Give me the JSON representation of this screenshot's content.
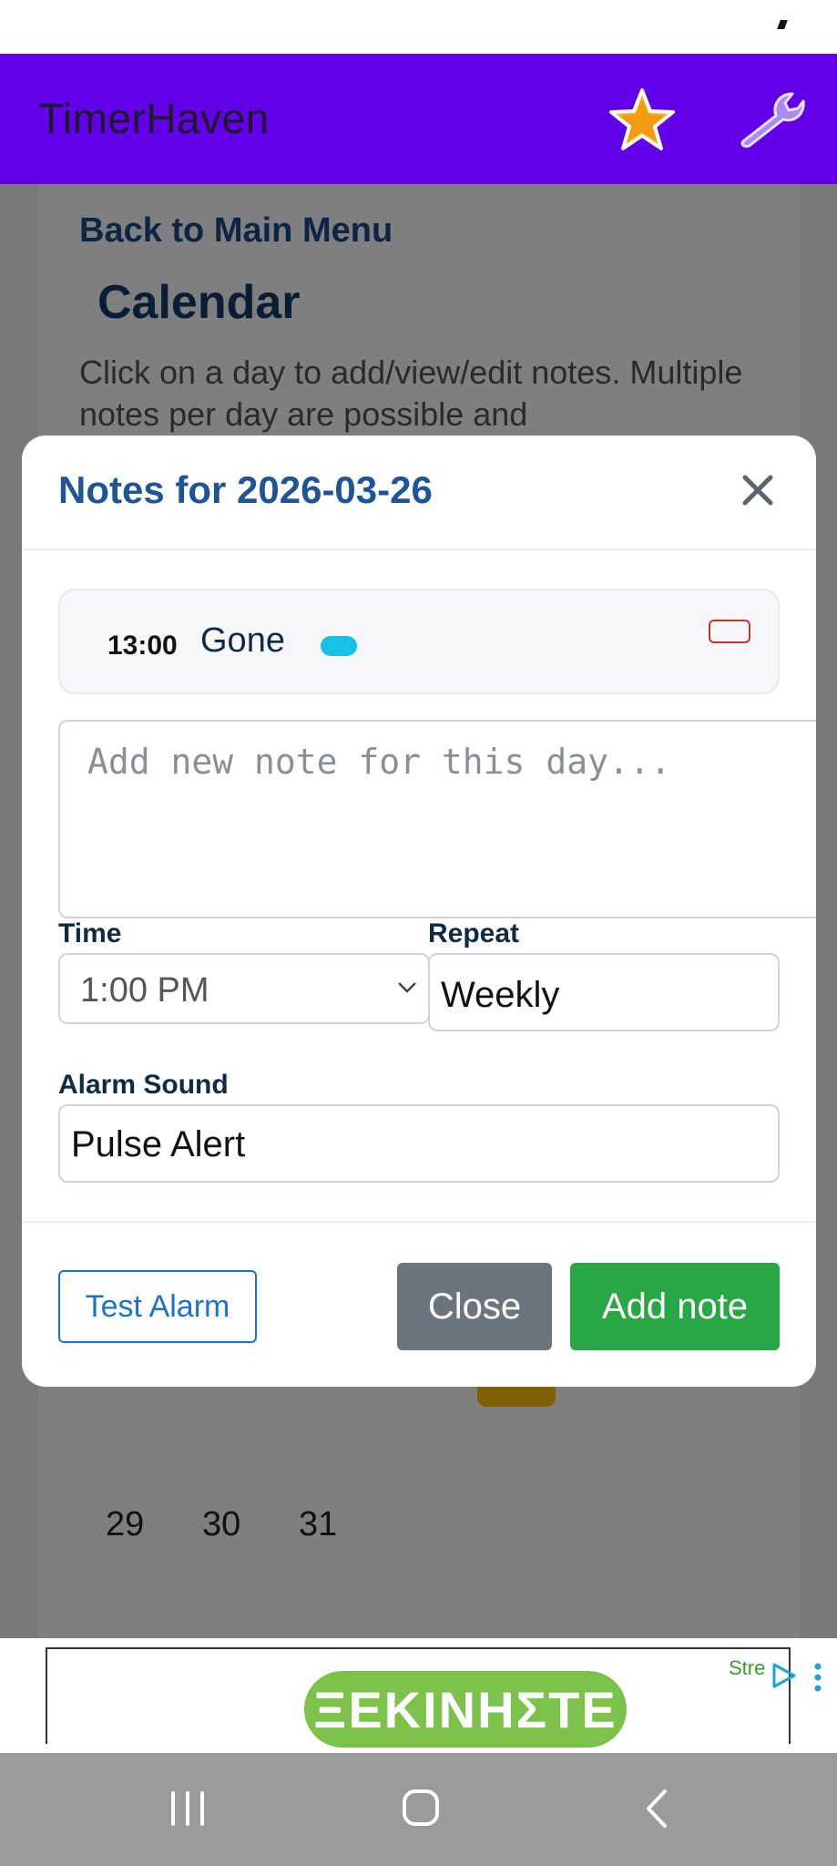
{
  "app": {
    "title": "TimerHaven",
    "icons": {
      "favorite": "star-icon",
      "settings": "wrench-icon"
    },
    "colors": {
      "appbar": "#6200ea",
      "link": "#1a4a8a"
    }
  },
  "page": {
    "back_link": "Back to Main Menu",
    "title": "Calendar",
    "description": "Click on a day to add/view/edit notes. Multiple notes per day are possible and",
    "visible_days": [
      "29",
      "30",
      "31"
    ]
  },
  "modal": {
    "title": "Notes for 2026-03-26",
    "notes": [
      {
        "time": "13:00",
        "text": "Gone"
      }
    ],
    "new_note_placeholder": "Add new note for this day...",
    "time": {
      "label": "Time",
      "value": "1:00 PM"
    },
    "repeat": {
      "label": "Repeat",
      "value": "Weekly"
    },
    "alarm_sound": {
      "label": "Alarm Sound",
      "value": "Pulse Alert"
    },
    "buttons": {
      "test_alarm": "Test Alarm",
      "close": "Close",
      "add_note": "Add note"
    },
    "colors": {
      "add": "#28a745",
      "close": "#6c757d",
      "test": "#1a73c9"
    }
  },
  "ad": {
    "cta": "ΞΕΚΙΝΗΣΤΕ",
    "brand_fragment": "Stre"
  }
}
